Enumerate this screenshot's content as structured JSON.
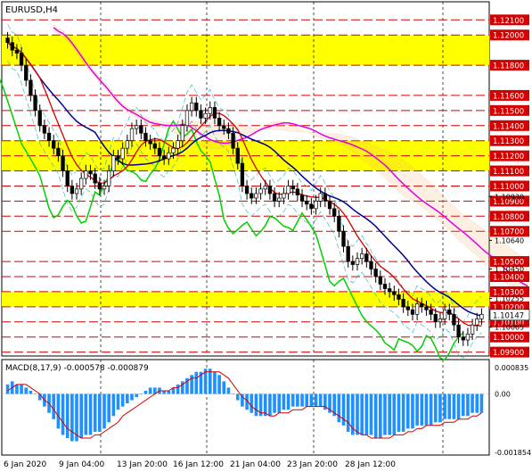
{
  "chart_data": {
    "type": "candlestick",
    "title": "EURUSD,H4",
    "price_axis_ylim": [
      1.0988,
      1.1222
    ],
    "price_levels": [
      {
        "value": 1.121,
        "label": "1.12100"
      },
      {
        "value": 1.12,
        "label": "1.12000"
      },
      {
        "value": 1.118,
        "label": "1.11800"
      },
      {
        "value": 1.116,
        "label": "1.11600"
      },
      {
        "value": 1.115,
        "label": "1.11500"
      },
      {
        "value": 1.114,
        "label": "1.11400"
      },
      {
        "value": 1.113,
        "label": "1.11300"
      },
      {
        "value": 1.112,
        "label": "1.11200"
      },
      {
        "value": 1.111,
        "label": "1.11100"
      },
      {
        "value": 1.11,
        "label": "1.11000"
      },
      {
        "value": 1.109,
        "label": "1.10900"
      },
      {
        "value": 1.108,
        "label": "1.10800"
      },
      {
        "value": 1.107,
        "label": "1.10700"
      },
      {
        "value": 1.105,
        "label": "1.10500"
      },
      {
        "value": 1.104,
        "label": "1.10400"
      },
      {
        "value": 1.103,
        "label": "1.10300"
      },
      {
        "value": 1.102,
        "label": "1.10200"
      },
      {
        "value": 1.101,
        "label": "1.10100"
      },
      {
        "value": 1.1,
        "label": "1.10000"
      },
      {
        "value": 1.099,
        "label": "1.09900"
      }
    ],
    "price_scale_labels": [
      {
        "value": 1.1093,
        "label": "1.10930"
      },
      {
        "value": 1.1064,
        "label": "1.10640"
      },
      {
        "value": 1.1045,
        "label": "1.10450"
      },
      {
        "value": 1.10255,
        "label": "1.10255"
      },
      {
        "value": 1.10065,
        "label": "1.10065"
      }
    ],
    "current_price": {
      "value": 1.10147,
      "label": "1.10147"
    },
    "zones": [
      {
        "from": 1.118,
        "to": 1.12,
        "color": "#ffff00"
      },
      {
        "from": 1.111,
        "to": 1.113,
        "color": "#ffff00"
      },
      {
        "from": 1.102,
        "to": 1.103,
        "color": "#ffff00"
      }
    ],
    "time_labels": [
      "6 Jan 2020",
      "9 Jan 04:00",
      "13 Jan 20:00",
      "16 Jan 12:00",
      "21 Jan 04:00",
      "23 Jan 20:00",
      "28 Jan 12:00"
    ],
    "candles_count": 104,
    "close": [
      1.1195,
      1.119,
      1.1188,
      1.118,
      1.117,
      1.116,
      1.115,
      1.114,
      1.1135,
      1.113,
      1.1125,
      1.112,
      1.111,
      1.11,
      1.1095,
      1.1098,
      1.1105,
      1.111,
      1.1108,
      1.1102,
      1.1098,
      1.11,
      1.111,
      1.112,
      1.1118,
      1.1125,
      1.113,
      1.1138,
      1.114,
      1.1135,
      1.113,
      1.1128,
      1.1125,
      1.112,
      1.1118,
      1.1122,
      1.1125,
      1.113,
      1.114,
      1.115,
      1.1155,
      1.115,
      1.1145,
      1.1148,
      1.1152,
      1.1145,
      1.114,
      1.1138,
      1.1135,
      1.1125,
      1.1115,
      1.11,
      1.1095,
      1.1092,
      1.1095,
      1.1098,
      1.11,
      1.1095,
      1.109,
      1.1092,
      1.1095,
      1.11,
      1.1098,
      1.1094,
      1.109,
      1.1088,
      1.1085,
      1.109,
      1.1095,
      1.109,
      1.1085,
      1.108,
      1.107,
      1.106,
      1.105,
      1.1048,
      1.1052,
      1.1055,
      1.105,
      1.1045,
      1.104,
      1.1035,
      1.1032,
      1.103,
      1.1028,
      1.1025,
      1.102,
      1.1018,
      1.1015,
      1.1022,
      1.102,
      1.1018,
      1.1015,
      1.101,
      1.1012,
      1.1018,
      1.1015,
      1.1008,
      1.1,
      1.0998,
      1.1002,
      1.1008,
      1.1012,
      1.1015
    ],
    "macd": {
      "label": "MACD(8,17,9) -0.000578 -0.000879",
      "ylim": [
        -0.001854,
        0.000835
      ],
      "tick_labels": [
        {
          "value": 0.000835,
          "label": "0.000835"
        },
        {
          "value": 0.0,
          "label": "0.00"
        },
        {
          "value": -0.001854,
          "label": "-0.001854"
        }
      ],
      "histogram": [
        0.0003,
        0.0004,
        0.0003,
        0.0003,
        0.0002,
        0.0001,
        0.0,
        -0.0002,
        -0.0004,
        -0.0006,
        -0.0008,
        -0.0011,
        -0.0013,
        -0.0014,
        -0.0015,
        -0.0015,
        -0.0014,
        -0.0013,
        -0.0013,
        -0.0012,
        -0.0012,
        -0.0011,
        -0.0009,
        -0.0007,
        -0.0005,
        -0.0004,
        -0.0003,
        -0.0002,
        -0.0001,
        0.0,
        0.0001,
        0.0002,
        0.0002,
        0.0002,
        0.0001,
        0.0001,
        0.0002,
        0.0003,
        0.0004,
        0.0005,
        0.0006,
        0.0007,
        0.0007,
        0.0008,
        0.0008,
        0.0007,
        0.0006,
        0.0004,
        0.0002,
        0.0,
        -0.0002,
        -0.0004,
        -0.0005,
        -0.0006,
        -0.0007,
        -0.0007,
        -0.0007,
        -0.0007,
        -0.0006,
        -0.0006,
        -0.0005,
        -0.0005,
        -0.0004,
        -0.0004,
        -0.0004,
        -0.0004,
        -0.0004,
        -0.0004,
        -0.0004,
        -0.0005,
        -0.0006,
        -0.0007,
        -0.0009,
        -0.001,
        -0.0012,
        -0.0013,
        -0.0013,
        -0.0013,
        -0.0013,
        -0.0013,
        -0.0014,
        -0.0014,
        -0.0013,
        -0.0013,
        -0.0013,
        -0.0012,
        -0.0012,
        -0.0011,
        -0.0011,
        -0.001,
        -0.001,
        -0.001,
        -0.001,
        -0.0009,
        -0.0009,
        -0.0008,
        -0.0008,
        -0.0008,
        -0.0008,
        -0.0007,
        -0.0007,
        -0.0006,
        -0.0006,
        -0.0006
      ],
      "signal": [
        0.0001,
        0.0002,
        0.0003,
        0.0003,
        0.0003,
        0.0002,
        0.0001,
        0.0,
        -0.0002,
        -0.0003,
        -0.0005,
        -0.0007,
        -0.0009,
        -0.0011,
        -0.0012,
        -0.0013,
        -0.0014,
        -0.0014,
        -0.0014,
        -0.0013,
        -0.0013,
        -0.0012,
        -0.0011,
        -0.001,
        -0.0009,
        -0.0007,
        -0.0006,
        -0.0005,
        -0.0004,
        -0.0003,
        -0.0002,
        -0.0001,
        0.0,
        0.0001,
        0.0001,
        0.0001,
        0.0002,
        0.0002,
        0.0003,
        0.0004,
        0.0005,
        0.0005,
        0.0006,
        0.0007,
        0.0007,
        0.0007,
        0.0007,
        0.0006,
        0.0005,
        0.0003,
        0.0001,
        -0.0001,
        -0.0002,
        -0.0004,
        -0.0005,
        -0.0006,
        -0.0006,
        -0.0007,
        -0.0007,
        -0.0006,
        -0.0006,
        -0.0006,
        -0.0005,
        -0.0005,
        -0.0005,
        -0.0004,
        -0.0004,
        -0.0004,
        -0.0004,
        -0.0004,
        -0.0005,
        -0.0006,
        -0.0007,
        -0.0008,
        -0.0009,
        -0.0011,
        -0.0012,
        -0.0013,
        -0.0013,
        -0.0014,
        -0.0014,
        -0.0014,
        -0.0014,
        -0.0014,
        -0.0013,
        -0.0013,
        -0.0013,
        -0.0012,
        -0.0012,
        -0.0011,
        -0.0011,
        -0.001,
        -0.001,
        -0.001,
        -0.001,
        -0.0009,
        -0.0009,
        -0.0009,
        -0.0008,
        -0.0008,
        -0.0008,
        -0.0007,
        -0.0007,
        -0.0006
      ]
    }
  },
  "colors": {
    "zone": "#ffff00",
    "level_line": "#d40000",
    "grid": "#000000",
    "candle_up": "#ffffff",
    "candle_down": "#000000",
    "histogram": "#1e90ff",
    "signal": "#d40000",
    "ma_fast": "#d40000",
    "ma_slow": "#00008b",
    "green_line": "#00d000",
    "magenta_line": "#e000e0",
    "cloud": "#f4a460",
    "price_label_bg": "#ffffff"
  }
}
